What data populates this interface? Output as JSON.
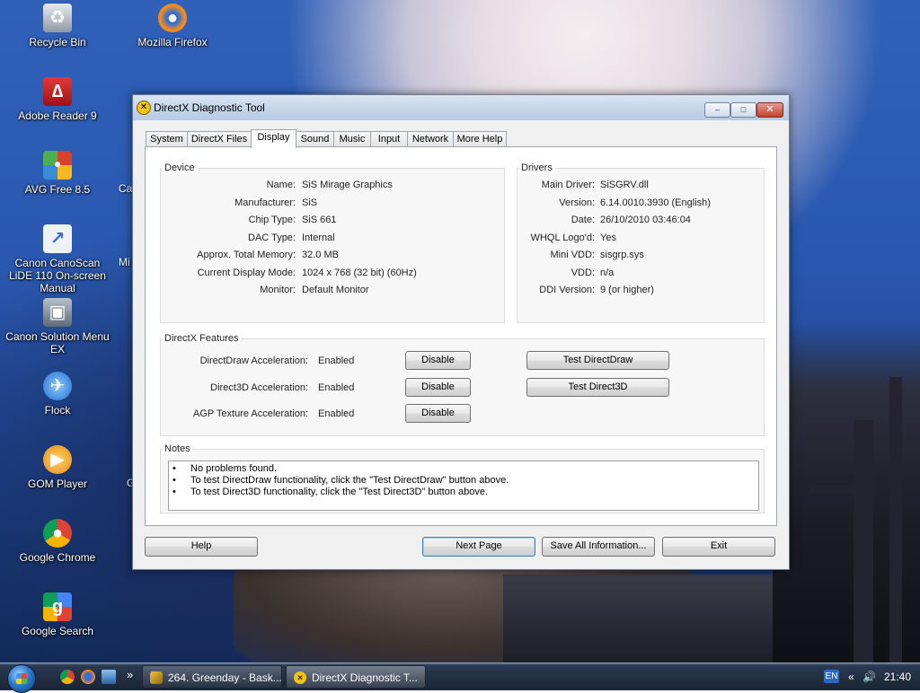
{
  "desktop": {
    "icons": [
      {
        "label": "Recycle Bin",
        "icon": "recycle-bin-icon",
        "color": "#9aa3ad"
      },
      {
        "label": "Mozilla Firefox",
        "icon": "firefox-icon",
        "color": "#e8791d"
      },
      {
        "label": "Adobe Reader 9",
        "icon": "adobe-reader-icon",
        "color": "#c8202a"
      },
      {
        "label": "AVG Free 8.5",
        "icon": "avg-icon",
        "color": "#d8422c"
      },
      {
        "label": "Canon CanoScan LiDE 110 On-screen Manual",
        "icon": "document-icon",
        "color": "#dfe6ef"
      },
      {
        "label": "Canon Solution Menu EX",
        "icon": "canon-icon",
        "color": "#7c8796"
      },
      {
        "label": "Flock",
        "icon": "flock-icon",
        "color": "#3b8de0"
      },
      {
        "label": "GOM Player",
        "icon": "gom-player-icon",
        "color": "#f29b1d"
      },
      {
        "label": "Google Chrome",
        "icon": "chrome-icon",
        "color": "#3a9a47"
      },
      {
        "label": "Google Search",
        "icon": "google-search-icon",
        "color": "#e24a3b"
      }
    ],
    "partial_labels": [
      "Ca",
      "Mi",
      "G"
    ]
  },
  "window": {
    "title": "DirectX Diagnostic Tool",
    "controls": {
      "minimize": "–",
      "maximize": "□",
      "close": "✕"
    },
    "tabs": [
      "System",
      "DirectX Files",
      "Display",
      "Sound",
      "Music",
      "Input",
      "Network",
      "More Help"
    ],
    "active_tab": "Display",
    "device": {
      "label": "Device",
      "rows": [
        {
          "key": "Name:",
          "value": "SiS Mirage Graphics"
        },
        {
          "key": "Manufacturer:",
          "value": "SiS"
        },
        {
          "key": "Chip Type:",
          "value": "SiS 661"
        },
        {
          "key": "DAC Type:",
          "value": "Internal"
        },
        {
          "key": "Approx. Total Memory:",
          "value": "32.0 MB"
        },
        {
          "key": "Current Display Mode:",
          "value": "1024 x 768 (32 bit) (60Hz)"
        },
        {
          "key": "Monitor:",
          "value": "Default Monitor"
        }
      ]
    },
    "drivers": {
      "label": "Drivers",
      "rows": [
        {
          "key": "Main Driver:",
          "value": "SiSGRV.dll"
        },
        {
          "key": "Version:",
          "value": "6.14.0010.3930 (English)"
        },
        {
          "key": "Date:",
          "value": "26/10/2010 03:46:04"
        },
        {
          "key": "WHQL Logo'd:",
          "value": "Yes"
        },
        {
          "key": "Mini VDD:",
          "value": "sisgrp.sys"
        },
        {
          "key": "VDD:",
          "value": "n/a"
        },
        {
          "key": "DDI Version:",
          "value": "9 (or higher)"
        }
      ]
    },
    "features": {
      "label": "DirectX Features",
      "rows": [
        {
          "key": "DirectDraw Acceleration:",
          "value": "Enabled",
          "button": "Disable",
          "test": "Test DirectDraw"
        },
        {
          "key": "Direct3D Acceleration:",
          "value": "Enabled",
          "button": "Disable",
          "test": "Test Direct3D"
        },
        {
          "key": "AGP Texture Acceleration:",
          "value": "Enabled",
          "button": "Disable"
        }
      ]
    },
    "notes": {
      "label": "Notes",
      "bullet": "•",
      "lines": [
        "No problems found.",
        "To test DirectDraw functionality, click the \"Test DirectDraw\" button above.",
        "To test Direct3D functionality, click the \"Test Direct3D\" button above."
      ]
    },
    "buttons": {
      "help": "Help",
      "next_page": "Next Page",
      "save_all": "Save All Information...",
      "exit": "Exit"
    }
  },
  "taskbar": {
    "quick_launch_more": "»",
    "tasks": [
      {
        "label": "264. Greenday - Bask...",
        "active": false
      },
      {
        "label": "DirectX Diagnostic T...",
        "active": true
      }
    ],
    "tray": {
      "language": "EN",
      "time": "21:40"
    }
  }
}
